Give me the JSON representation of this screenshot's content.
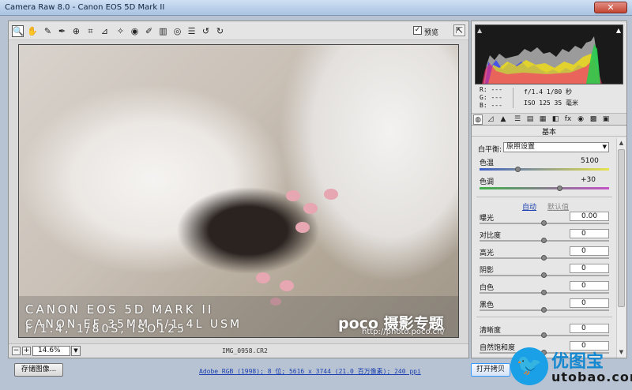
{
  "window": {
    "title": "Camera Raw 8.0  -  Canon EOS 5D Mark II",
    "close_glyph": "✕"
  },
  "toolbar": {
    "tools": [
      {
        "name": "zoom-tool-icon",
        "glyph": "🔍"
      },
      {
        "name": "hand-tool-icon",
        "glyph": "✋"
      },
      {
        "name": "white-balance-tool-icon",
        "glyph": "✎"
      },
      {
        "name": "color-sampler-tool-icon",
        "glyph": "✒"
      },
      {
        "name": "target-adjust-tool-icon",
        "glyph": "⊕"
      },
      {
        "name": "crop-tool-icon",
        "glyph": "⌗"
      },
      {
        "name": "straighten-tool-icon",
        "glyph": "⊿"
      },
      {
        "name": "spot-removal-tool-icon",
        "glyph": "✧"
      },
      {
        "name": "red-eye-tool-icon",
        "glyph": "◉"
      },
      {
        "name": "adjustment-brush-icon",
        "glyph": "✐"
      },
      {
        "name": "graduated-filter-icon",
        "glyph": "▥"
      },
      {
        "name": "radial-filter-icon",
        "glyph": "◎"
      },
      {
        "name": "preferences-icon",
        "glyph": "☰"
      },
      {
        "name": "rotate-ccw-icon",
        "glyph": "↺"
      },
      {
        "name": "rotate-cw-icon",
        "glyph": "↻"
      }
    ],
    "preview_label": "预览",
    "preview_checked": "✓",
    "fullscreen_glyph": "⇱"
  },
  "canvas": {
    "captions": [
      "CANON EOS 5D MARK II",
      "CANON EF 35MM F/1.4L USM",
      "F/1.4, 1/80S, ISO125"
    ],
    "watermark": "poco 摄影专题",
    "watermark_url": "http://photo.poco.cn/"
  },
  "zoom": {
    "minus": "−",
    "plus": "+",
    "value": "14.6%",
    "dropdown": "▼",
    "filename": "IMG_0958.CR2"
  },
  "bottom": {
    "save_label": "存储图像...",
    "workflow_info": "Adobe RGB (1998); 8 位; 5616 x 3744 (21.0 百万像素); 240 ppi",
    "open_label": "打开拷贝"
  },
  "logo": {
    "glyph": "🐦",
    "cn": "优图宝",
    "en": "utobao.com"
  },
  "histogram": {
    "clip_shadow": "▲",
    "clip_highlight": "▲"
  },
  "exif": {
    "r": "R:  ---",
    "g": "G:  ---",
    "b": "B:  ---",
    "aperture_shutter": "f/1.4   1/80 秒",
    "iso_focal": "ISO 125   35 毫米"
  },
  "panel_tabs": [
    "◍",
    "◿",
    "▲",
    "☰",
    "▤",
    "▦",
    "◧",
    "fx",
    "◉",
    "▩",
    "▣"
  ],
  "basic": {
    "section_title": "基本",
    "wb_label": "白平衡:",
    "wb_value": "原照设置",
    "temp_label": "色温",
    "temp_value": "5100",
    "tint_label": "色调",
    "tint_value": "+30",
    "auto_label": "自动",
    "default_label": "默认值",
    "sliders": [
      {
        "label": "曝光",
        "value": "0.00",
        "pos": 0.5
      },
      {
        "label": "对比度",
        "value": "0",
        "pos": 0.5
      },
      {
        "label": "高光",
        "value": "0",
        "pos": 0.5
      },
      {
        "label": "阴影",
        "value": "0",
        "pos": 0.5
      },
      {
        "label": "白色",
        "value": "0",
        "pos": 0.5
      },
      {
        "label": "黑色",
        "value": "0",
        "pos": 0.5
      },
      {
        "label": "清晰度",
        "value": "0",
        "pos": 0.5
      },
      {
        "label": "自然饱和度",
        "value": "0",
        "pos": 0.5
      }
    ],
    "temp_pos": 0.3,
    "tint_pos": 0.62
  },
  "colors": {
    "accent": "#1b3fb0",
    "logo_blue": "#1aa0e6"
  }
}
